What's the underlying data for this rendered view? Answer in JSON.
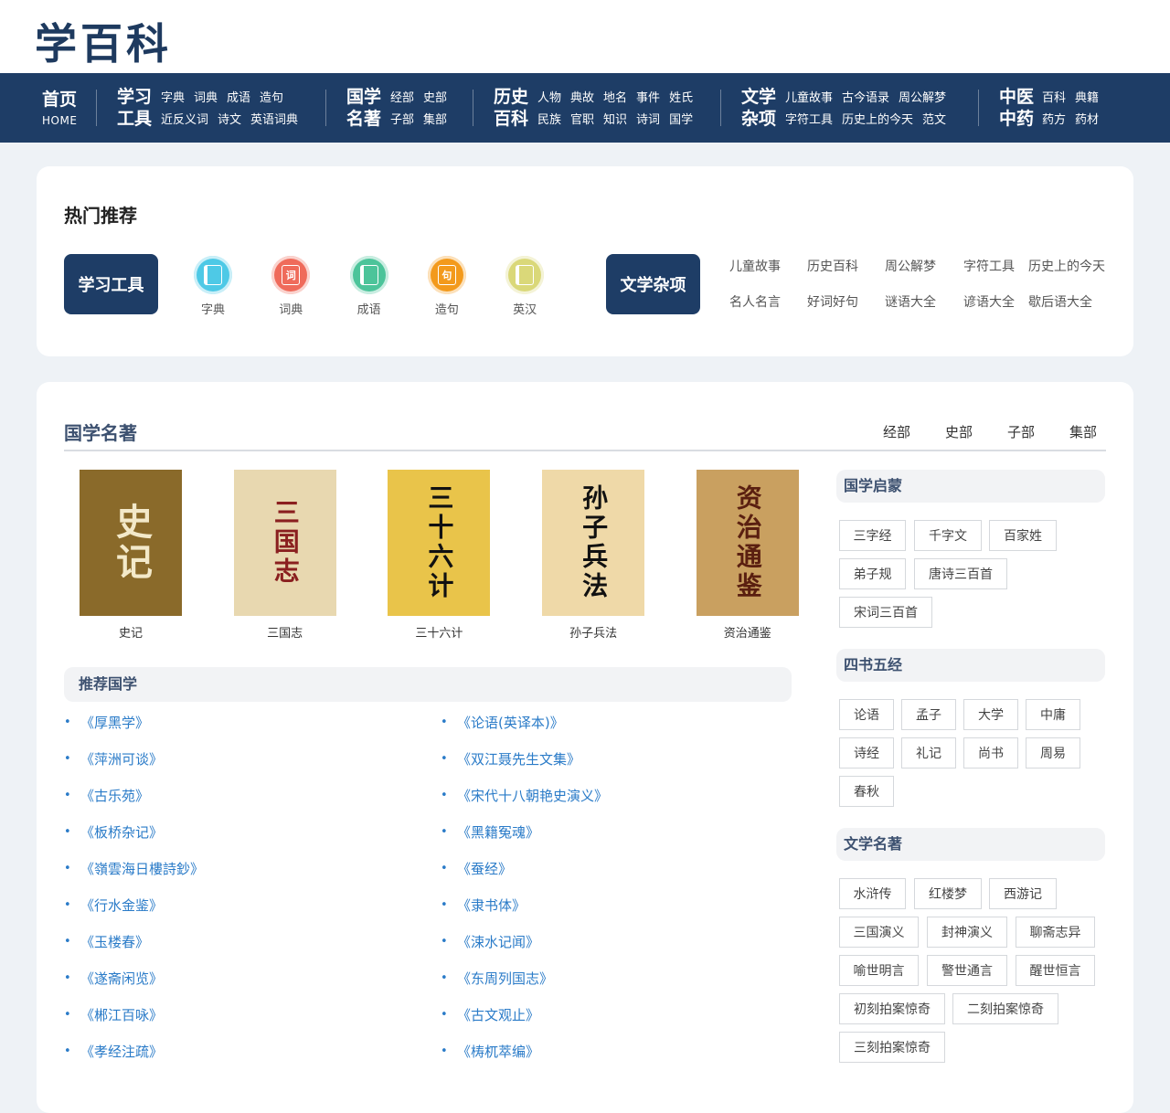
{
  "site": {
    "logo": "学百科"
  },
  "nav": {
    "home": {
      "label": "首页",
      "sub": "HOME"
    },
    "groups": [
      {
        "title": "学习工具",
        "rows": [
          [
            "字典",
            "词典",
            "成语",
            "造句"
          ],
          [
            "近反义词",
            "诗文",
            "英语词典"
          ]
        ]
      },
      {
        "title": "国学名著",
        "rows": [
          [
            "经部",
            "史部"
          ],
          [
            "子部",
            "集部"
          ]
        ]
      },
      {
        "title": "历史百科",
        "rows": [
          [
            "人物",
            "典故",
            "地名",
            "事件",
            "姓氏"
          ],
          [
            "民族",
            "官职",
            "知识",
            "诗词",
            "国学"
          ]
        ]
      },
      {
        "title": "文学杂项",
        "rows": [
          [
            "儿童故事",
            "古今语录",
            "周公解梦"
          ],
          [
            "字符工具",
            "历史上的今天",
            "范文"
          ]
        ]
      },
      {
        "title": "中医中药",
        "rows": [
          [
            "百科",
            "典籍"
          ],
          [
            "药方",
            "药材"
          ]
        ]
      }
    ]
  },
  "hot": {
    "title": "热门推荐",
    "study_label": "学习工具",
    "tools": [
      {
        "label": "字典",
        "glyph": "",
        "color": "#4ec9e6"
      },
      {
        "label": "词典",
        "glyph": "词",
        "color": "#ef6b5b"
      },
      {
        "label": "成语",
        "glyph": "",
        "color": "#4cc49a"
      },
      {
        "label": "造句",
        "glyph": "句",
        "color": "#f39a1c"
      },
      {
        "label": "英汉",
        "glyph": "",
        "color": "#dad879"
      }
    ],
    "lit_label": "文学杂项",
    "lit_links": [
      [
        "儿童故事",
        "历史百科",
        "周公解梦",
        "字符工具",
        "历史上的今天"
      ],
      [
        "名人名言",
        "好词好句",
        "谜语大全",
        "谚语大全",
        "歇后语大全"
      ]
    ]
  },
  "guoxue": {
    "title": "国学名著",
    "tabs": [
      "经部",
      "史部",
      "子部",
      "集部"
    ],
    "books": [
      {
        "title": "史记",
        "cover_text": "史记",
        "bg": "#8a6a2a"
      },
      {
        "title": "三国志",
        "cover_text": "三国志",
        "bg": "#e8d8b0"
      },
      {
        "title": "三十六计",
        "cover_text": "三十六计",
        "bg": "#e9c44a"
      },
      {
        "title": "孙子兵法",
        "cover_text": "孙子兵法",
        "bg": "#efd9a8"
      },
      {
        "title": "资治通鉴",
        "cover_text": "资治通鉴",
        "bg": "#c9a060"
      }
    ],
    "rec_title": "推荐国学",
    "rec_left": [
      "《厚黑学》",
      "《萍洲可谈》",
      "《古乐苑》",
      "《板桥杂记》",
      "《嶺雲海日樓詩鈔》",
      "《行水金鉴》",
      "《玉楼春》",
      "《遂斋闲览》",
      "《郴江百咏》",
      "《孝经注疏》"
    ],
    "rec_right": [
      "《论语(英译本)》",
      "《双江聂先生文集》",
      "《宋代十八朝艳史演义》",
      "《黑籍冤魂》",
      "《蚕经》",
      "《隶书体》",
      "《涑水记闻》",
      "《东周列国志》",
      "《古文观止》",
      "《梼杌萃编》"
    ]
  },
  "side": {
    "qimeng": {
      "title": "国学启蒙",
      "items": [
        "三字经",
        "千字文",
        "百家姓",
        "弟子规",
        "唐诗三百首",
        "宋词三百首"
      ]
    },
    "sishu": {
      "title": "四书五经",
      "items": [
        "论语",
        "孟子",
        "大学",
        "中庸",
        "诗经",
        "礼记",
        "尚书",
        "周易",
        "春秋"
      ]
    },
    "wenxue": {
      "title": "文学名著",
      "items": [
        "水浒传",
        "红楼梦",
        "西游记",
        "三国演义",
        "封神演义",
        "聊斋志异",
        "喻世明言",
        "警世通言",
        "醒世恒言",
        "初刻拍案惊奇",
        "二刻拍案惊奇",
        "三刻拍案惊奇"
      ]
    }
  }
}
